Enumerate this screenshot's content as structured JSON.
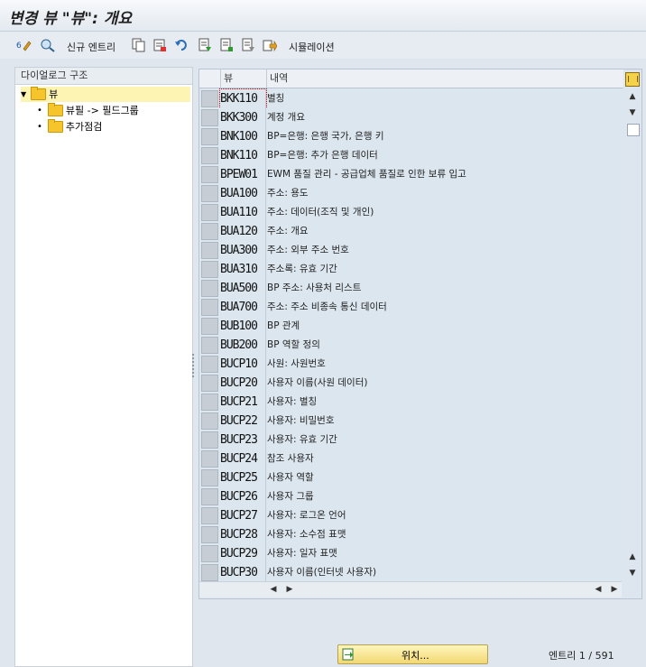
{
  "title": "변경 뷰 \"뷰\": 개요",
  "toolbar": {
    "new_entries_label": "신규 엔트리",
    "simulation_label": "시뮬레이션"
  },
  "left_pane": {
    "header": "다이얼로그 구조",
    "tree": [
      {
        "label": "뷰",
        "level": 0,
        "expanded": true,
        "selected": true
      },
      {
        "label": "뷰필 -> 필드그룹",
        "level": 1
      },
      {
        "label": "추가점검",
        "level": 1
      }
    ]
  },
  "table": {
    "columns": [
      "뷰",
      "내역"
    ],
    "rows": [
      {
        "code": "BKK110",
        "desc": "별칭"
      },
      {
        "code": "BKK300",
        "desc": "계정 개요"
      },
      {
        "code": "BNK100",
        "desc": "BP=은행: 은행 국가, 은행 키"
      },
      {
        "code": "BNK110",
        "desc": "BP=은행: 추가 은행 데이터"
      },
      {
        "code": "BPEW01",
        "desc": "EWM 품질 관리 - 공급업체 품질로 인한 보류 입고"
      },
      {
        "code": "BUA100",
        "desc": "주소: 용도"
      },
      {
        "code": "BUA110",
        "desc": "주소: 데이터(조직 및 개인)"
      },
      {
        "code": "BUA120",
        "desc": "주소: 개요"
      },
      {
        "code": "BUA300",
        "desc": "주소: 외부 주소 번호"
      },
      {
        "code": "BUA310",
        "desc": "주소록: 유효 기간"
      },
      {
        "code": "BUA500",
        "desc": "BP 주소: 사용처 리스트"
      },
      {
        "code": "BUA700",
        "desc": "주소: 주소 비종속 통신 데이터"
      },
      {
        "code": "BUB100",
        "desc": "BP 관계"
      },
      {
        "code": "BUB200",
        "desc": "BP 역할 정의"
      },
      {
        "code": "BUCP10",
        "desc": "사원: 사원번호"
      },
      {
        "code": "BUCP20",
        "desc": "사용자 이름(사원 데이터)"
      },
      {
        "code": "BUCP21",
        "desc": "사용자: 별칭"
      },
      {
        "code": "BUCP22",
        "desc": "사용자: 비밀번호"
      },
      {
        "code": "BUCP23",
        "desc": "사용자: 유효 기간"
      },
      {
        "code": "BUCP24",
        "desc": "참조 사용자"
      },
      {
        "code": "BUCP25",
        "desc": "사용자 역할"
      },
      {
        "code": "BUCP26",
        "desc": "사용자 그룹"
      },
      {
        "code": "BUCP27",
        "desc": "사용자: 로그온 언어"
      },
      {
        "code": "BUCP28",
        "desc": "사용자: 소수점 표맷"
      },
      {
        "code": "BUCP29",
        "desc": "사용자: 일자 표맷"
      },
      {
        "code": "BUCP30",
        "desc": "사용자 이름(인터넷 사용자)"
      }
    ]
  },
  "footer": {
    "position_button": "위치...",
    "entries_label": "엔트리",
    "entries_value": "1 / 591"
  },
  "colors": {
    "accent": "#f2d873",
    "row_bg": "#dce6ef",
    "folder": "#f5c52b"
  }
}
